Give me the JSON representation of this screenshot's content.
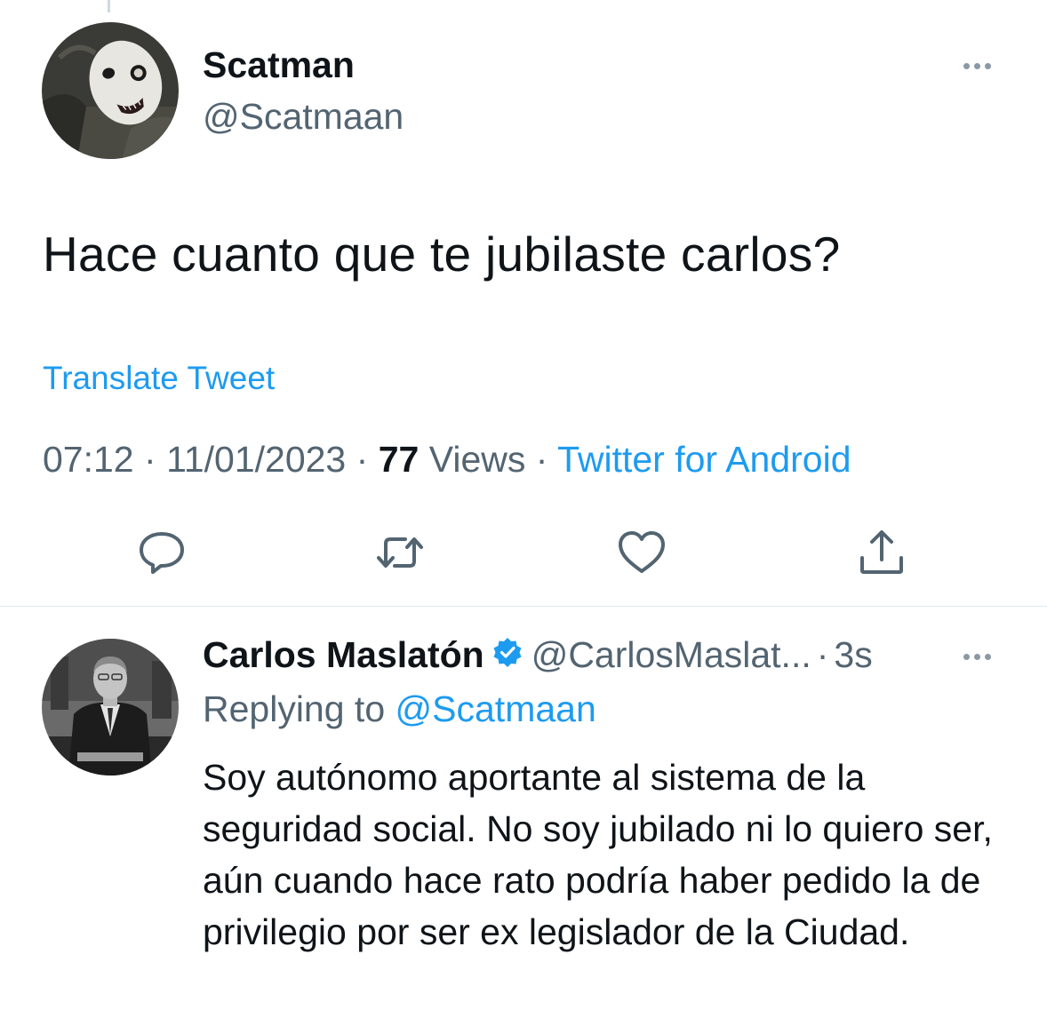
{
  "tweet": {
    "author": {
      "name": "Scatman",
      "handle": "@Scatmaan",
      "avatar_icon": "masked-face-avatar"
    },
    "text": "Hace cuanto que te jubilaste carlos?",
    "translate_label": "Translate Tweet",
    "meta": {
      "time": "07:12",
      "separator": "·",
      "date": "11/01/2023",
      "views_count": "77",
      "views_label": "Views",
      "source": "Twitter for Android"
    },
    "actions": {
      "reply_icon": "reply-bubble-icon",
      "retweet_icon": "retweet-icon",
      "like_icon": "heart-icon",
      "share_icon": "share-icon"
    }
  },
  "reply": {
    "author": {
      "name": "Carlos Maslatón",
      "verified": true,
      "handle": "@CarlosMaslat...",
      "time": "3s",
      "separator": "·",
      "avatar_icon": "man-in-suit-avatar"
    },
    "replying_prefix": "Replying to",
    "replying_mention": "@Scatmaan",
    "text": "Soy autónomo aportante al sistema de la seguridad social. No soy jubilado ni lo quiero ser, aún cuando hace rato podría haber pedido la de privilegio por ser ex legislador de la Ciudad."
  },
  "colors": {
    "accent": "#1d9bf0",
    "secondary_text": "#536471",
    "primary_text": "#0f1419"
  }
}
